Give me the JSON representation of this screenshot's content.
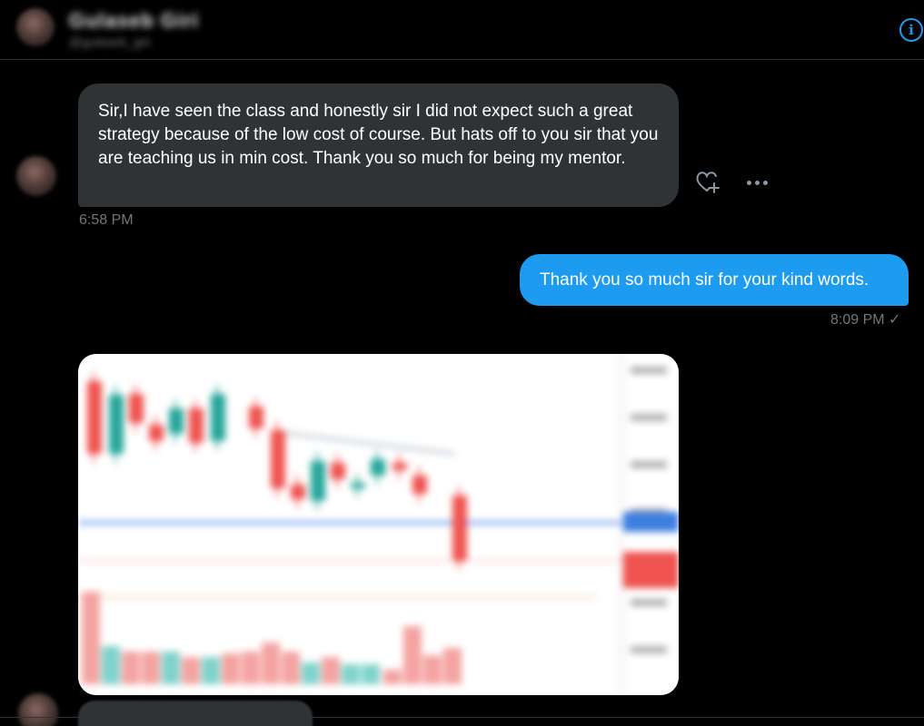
{
  "header": {
    "contact_name": "Gulaseb Giri",
    "contact_handle": "@gulaseb_giri",
    "info_icon": "info-icon"
  },
  "messages": [
    {
      "direction": "incoming",
      "text": "Sir,I have seen the class and honestly sir I did not expect such a great strategy because of the low cost of course. But hats off to you sir that you are teaching us in min cost. Thank you so much for being my mentor.",
      "time": "6:58 PM"
    },
    {
      "direction": "outgoing",
      "text": "Thank you so much sir for your kind words.",
      "time": "8:09 PM",
      "status": "✓"
    },
    {
      "direction": "incoming",
      "type": "image",
      "image": "candlestick-chart-screenshot"
    }
  ],
  "message_actions": {
    "react_icon": "heart-plus-icon",
    "more_icon": "more-horizontal-icon"
  },
  "colors": {
    "background": "#000000",
    "incoming_bubble": "#2f3336",
    "outgoing_bubble": "#1d9bf0",
    "accent": "#1d9bf0",
    "timestamp": "#71767b",
    "candle_up": "#26a69a",
    "candle_down": "#ef5350"
  }
}
